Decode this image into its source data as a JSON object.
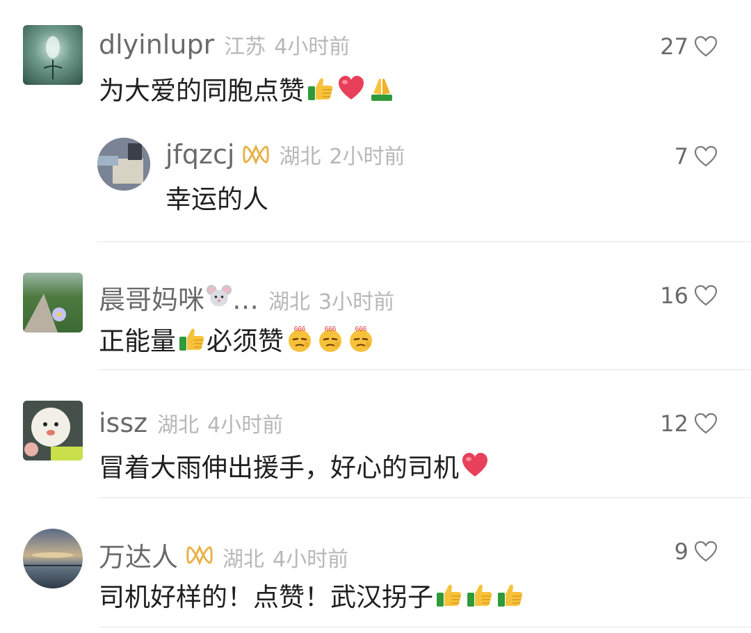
{
  "comments": [
    {
      "username": "dlyinlupr",
      "location": "江苏",
      "time": "4小时前",
      "text": "为大爱的同胞点赞",
      "likes": "27",
      "emojis": [
        "thumbs-up-icon",
        "heart-icon",
        "praying-hands-icon"
      ]
    },
    {
      "username": "jfqzcj",
      "location": "湖北",
      "time": "2小时前",
      "text": "幸运的人",
      "likes": "7",
      "has_badge": true
    },
    {
      "username": "晨哥妈咪",
      "username_suffix": "…",
      "location": "湖北",
      "time": "3小时前",
      "text_a": "正能量",
      "text_b": "必须赞",
      "likes": "16",
      "emojis": [
        "mouse-face-icon",
        "thumbs-up-icon",
        "666-emoji-icon"
      ],
      "emoji_label": "666"
    },
    {
      "username": "issz",
      "location": "湖北",
      "time": "4小时前",
      "text": "冒着大雨伸出援手，好心的司机",
      "likes": "12",
      "emojis": [
        "heart-icon"
      ]
    },
    {
      "username": "万达人",
      "location": "湖北",
      "time": "4小时前",
      "text": "司机好样的！点赞！武汉拐子",
      "likes": "9",
      "has_badge": true,
      "emojis": [
        "thumbs-up-icon"
      ]
    }
  ],
  "colors": {
    "username": "#6a6a6a",
    "meta": "#b7b7b7",
    "text": "#1f1f1f",
    "badge": "#e8b24a",
    "divider": "#e5e5e5"
  }
}
